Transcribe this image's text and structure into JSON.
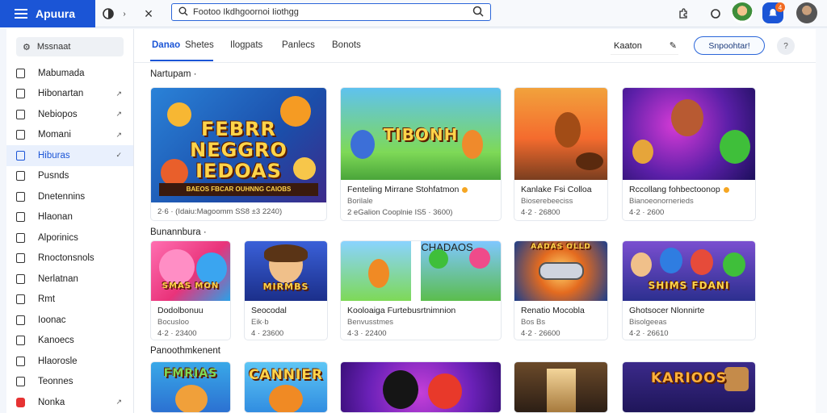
{
  "app": {
    "title": "Apuura"
  },
  "search": {
    "value": "Footoo Ikdhgoornoi Iiothgg"
  },
  "topbar": {
    "icons": [
      "menu-icon",
      "close-icon",
      "puzzle-icon",
      "circle-icon",
      "character-icon",
      "notification-icon",
      "profile-icon"
    ],
    "notification_count": "4"
  },
  "sidebar": {
    "search_label": "Mssnaat",
    "items": [
      {
        "label": "Mabumada",
        "arrow": ""
      },
      {
        "label": "Hibonartan",
        "arrow": "↗"
      },
      {
        "label": "Nebiopos",
        "arrow": "↗"
      },
      {
        "label": "Momani",
        "arrow": "↗"
      },
      {
        "label": "Hiburas",
        "arrow": "✓"
      },
      {
        "label": "Pusnds",
        "arrow": ""
      },
      {
        "label": "Dnetennins",
        "arrow": ""
      },
      {
        "label": "Hlaonan",
        "arrow": ""
      },
      {
        "label": "Alporinics",
        "arrow": ""
      },
      {
        "label": "Rnoctonsnols",
        "arrow": ""
      },
      {
        "label": "Nerlatnan",
        "arrow": ""
      },
      {
        "label": "Rmt",
        "arrow": ""
      },
      {
        "label": "Ioonac",
        "arrow": ""
      },
      {
        "label": "Kanoecs",
        "arrow": ""
      },
      {
        "label": "Hlaorosle",
        "arrow": ""
      },
      {
        "label": "Teonnes",
        "arrow": ""
      },
      {
        "label": "Nonka",
        "arrow": "↗"
      }
    ],
    "active_index": 4,
    "red_index": 16
  },
  "tabs": [
    "Danao",
    "Shetes",
    "Ilogpats",
    "Panlecs",
    "Bonots"
  ],
  "toolbar": {
    "filter_label": "Kaaton",
    "cta_label": "Snpoohtar!",
    "help_label": "?"
  },
  "sections": [
    {
      "title": "Nartupam ·"
    },
    {
      "title": "Bunannbura ·"
    },
    {
      "title": "Panoothmkenent"
    }
  ],
  "cards_row1": [
    {
      "art": "FEBRR NEGGRO IEDOAS",
      "banner": "BAEOS FBCAR OUHNNG CAIOBS",
      "title": "",
      "sub": "",
      "meta": "2·6 · (Idaiu:Magoomm SS8 ±3 2240)"
    },
    {
      "art": "TIBONH",
      "banner": "",
      "title": "Fenteling Mirrane Stohfatmon",
      "sub": "Borilale",
      "meta": "2 eGalion Cooplnie IS5 · 3600)"
    },
    {
      "art": "",
      "banner": "",
      "title": "Kanlake Fsi Colloa",
      "sub": "Bioserebeeciss",
      "meta": "4·2 · 26800"
    },
    {
      "art": "",
      "banner": "",
      "title": "Rccollang fohbectoonop",
      "sub": "Bianoeonornerieds",
      "meta": "4·2 · 2600"
    }
  ],
  "cards_row2": [
    {
      "art": "SMAS MON",
      "title": "Dodolbonuu",
      "sub": "Bocusloo",
      "meta": "4·2 · 23400"
    },
    {
      "art": "MIRMBS",
      "title": "Seocodal",
      "sub": "Eik·b",
      "meta": "4 · 23600"
    },
    {
      "art": "CHADAOS",
      "title": "Kooloaiga Furtebusrtnimnion",
      "sub": "Benvusstmes",
      "meta": "4·3 · 22400"
    },
    {
      "art": "AADAS OLLD",
      "title": "Renatio Mocobla",
      "sub": "Bos Bs",
      "meta": "4·2 · 26600"
    },
    {
      "art": "SHIMS FDANI",
      "title": "Ghotsocer Nlonnirte",
      "sub": "Bisolgeeas",
      "meta": "4·2 · 26610"
    }
  ],
  "cards_row3": [
    {
      "art": "FMRIAS"
    },
    {
      "art": "CANNIER"
    },
    {
      "art": ""
    },
    {
      "art": ""
    },
    {
      "art": "KARIOOS"
    }
  ]
}
